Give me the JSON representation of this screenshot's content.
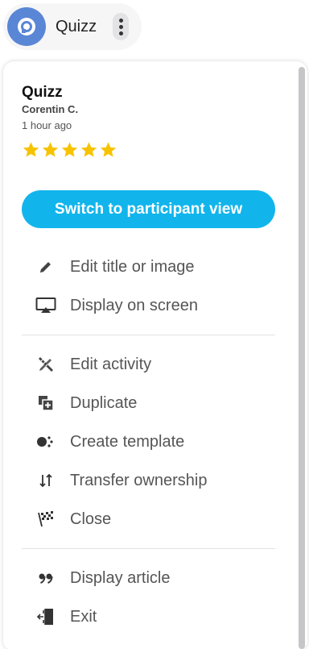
{
  "header": {
    "app_name": "Quizz",
    "logo_icon": "app-logo-icon",
    "menu_icon": "kebab-menu-icon"
  },
  "card": {
    "title": "Quizz",
    "author": "Corentin C.",
    "time_ago": "1 hour ago",
    "rating": 5,
    "rating_max": 5,
    "star_color": "#f7c300"
  },
  "primary_button": {
    "label": "Switch to participant view",
    "color": "#11b5ec"
  },
  "menu": {
    "group1": [
      {
        "label": "Edit title or image",
        "icon": "pencil-icon"
      },
      {
        "label": "Display on screen",
        "icon": "airplay-screen-icon"
      }
    ],
    "group2": [
      {
        "label": "Edit activity",
        "icon": "pencil-ruler-icon"
      },
      {
        "label": "Duplicate",
        "icon": "duplicate-icon"
      },
      {
        "label": "Create template",
        "icon": "template-icon"
      },
      {
        "label": "Transfer ownership",
        "icon": "transfer-arrows-icon"
      },
      {
        "label": "Close",
        "icon": "checkered-flag-icon"
      }
    ],
    "group3": [
      {
        "label": "Display article",
        "icon": "quote-icon"
      },
      {
        "label": "Exit",
        "icon": "exit-door-icon"
      }
    ]
  }
}
